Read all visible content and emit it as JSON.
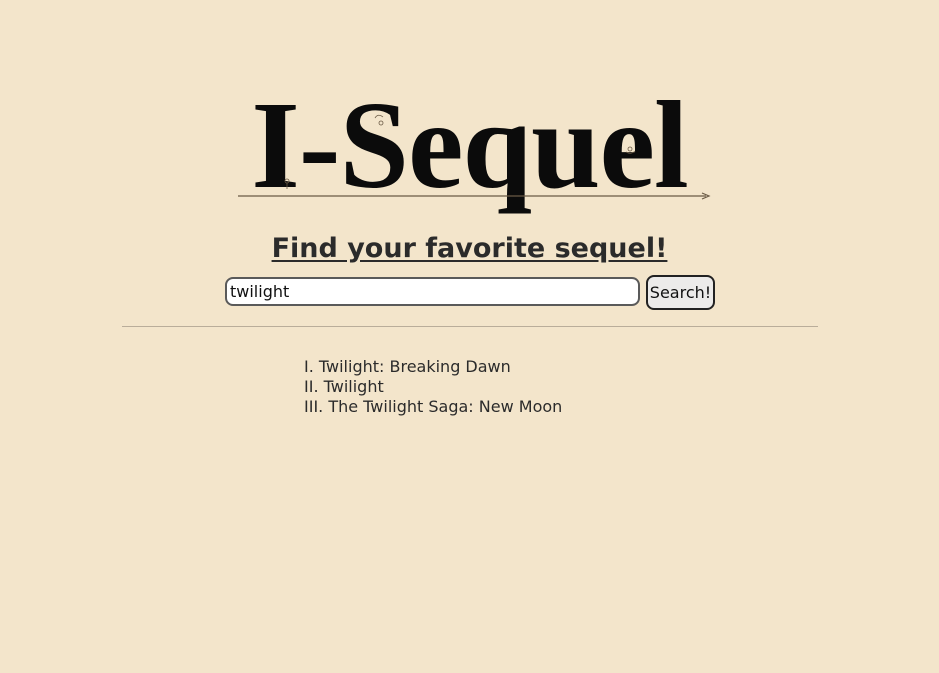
{
  "logo": {
    "text": "I-Sequel"
  },
  "tagline": "Find your favorite sequel!",
  "search": {
    "value": "twilight",
    "button_label": "Search!"
  },
  "results": [
    "I. Twilight: Breaking Dawn",
    "II. Twilight",
    "III. The Twilight Saga: New Moon"
  ],
  "colors": {
    "background": "#f3e5cb",
    "logo": "#0b0b0b",
    "text": "#2b2b2b"
  }
}
